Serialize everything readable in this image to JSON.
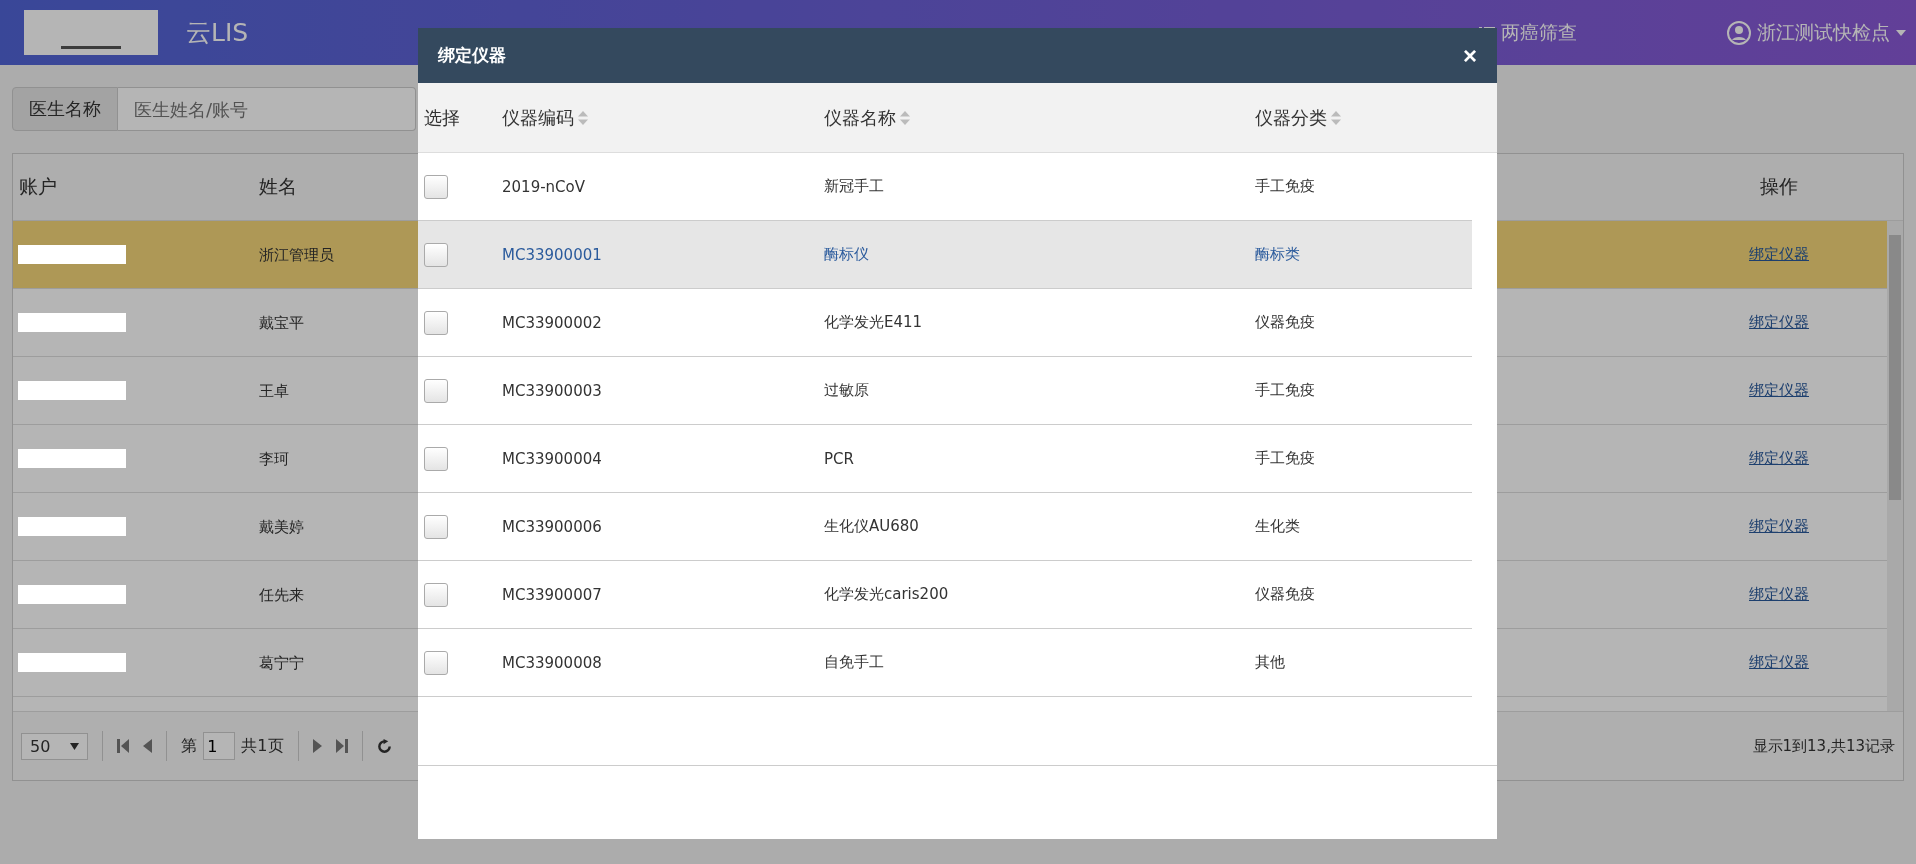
{
  "header": {
    "app_title": "云LIS",
    "nav_items": [
      {
        "label": "两癌筛查"
      }
    ],
    "user": "浙江测试快检点"
  },
  "search": {
    "label": "医生名称",
    "placeholder": "医生姓名/账号"
  },
  "table": {
    "columns": [
      "账户",
      "姓名",
      "操作"
    ],
    "rows": [
      {
        "name": "浙江管理员",
        "action": "绑定仪器",
        "selected": true
      },
      {
        "name": "戴宝平",
        "action": "绑定仪器",
        "selected": false
      },
      {
        "name": "王卓",
        "action": "绑定仪器",
        "selected": false
      },
      {
        "name": "李珂",
        "action": "绑定仪器",
        "selected": false
      },
      {
        "name": "戴美婷",
        "action": "绑定仪器",
        "selected": false
      },
      {
        "name": "任先来",
        "action": "绑定仪器",
        "selected": false
      },
      {
        "name": "葛宁宁",
        "action": "绑定仪器",
        "selected": false
      }
    ]
  },
  "pagination": {
    "page_size": "50",
    "page_prefix": "第",
    "page": "1",
    "page_suffix": "共1页",
    "summary": "显示1到13,共13记录"
  },
  "dialog": {
    "title": "绑定仪器",
    "close": "×",
    "columns": [
      "选择",
      "仪器编码",
      "仪器名称",
      "仪器分类"
    ],
    "rows": [
      {
        "code": "2019-nCoV",
        "name": "新冠手工",
        "category": "手工免疫",
        "checked": false,
        "selected": false
      },
      {
        "code": "MC33900001",
        "name": "酶标仪",
        "category": "酶标类",
        "checked": false,
        "selected": true
      },
      {
        "code": "MC33900002",
        "name": "化学发光E411",
        "category": "仪器免疫",
        "checked": false,
        "selected": false
      },
      {
        "code": "MC33900003",
        "name": "过敏原",
        "category": "手工免疫",
        "checked": false,
        "selected": false
      },
      {
        "code": "MC33900004",
        "name": "PCR",
        "category": "手工免疫",
        "checked": false,
        "selected": false
      },
      {
        "code": "MC33900006",
        "name": "生化仪AU680",
        "category": "生化类",
        "checked": false,
        "selected": false
      },
      {
        "code": "MC33900007",
        "name": "化学发光caris200",
        "category": "仪器免疫",
        "checked": false,
        "selected": false
      },
      {
        "code": "MC33900008",
        "name": "自免手工",
        "category": "其他",
        "checked": false,
        "selected": false
      }
    ]
  }
}
